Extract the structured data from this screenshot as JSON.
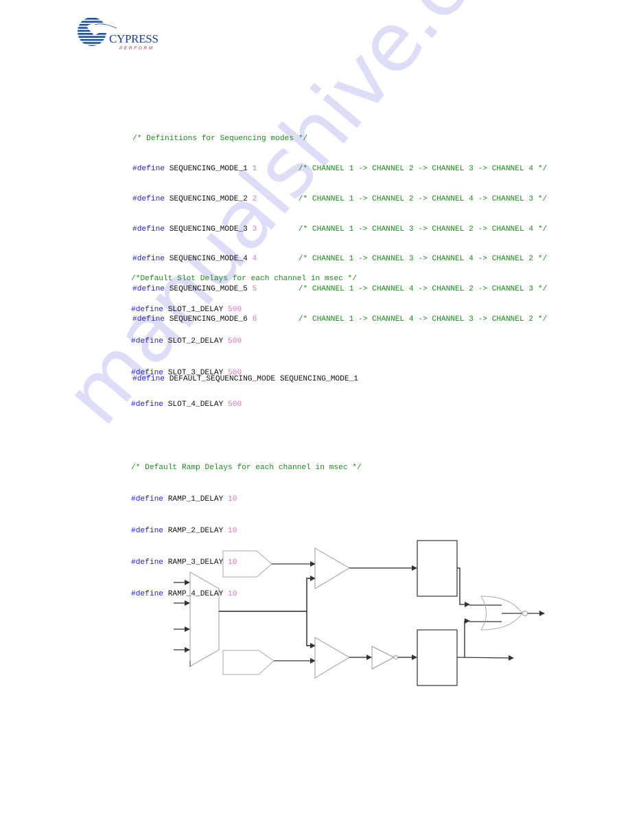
{
  "header": {
    "logo": {
      "brand": "CYPRESS",
      "tagline": "PERFORM",
      "colors": {
        "brand": "#1b3f8f",
        "tagline": "#c0312b"
      }
    }
  },
  "code_block_1": {
    "comment": "/* Definitions for Sequencing modes */",
    "defines": [
      {
        "keyword": "#define",
        "name": "SEQUENCING_MODE_1",
        "value": "1",
        "comment": "/* CHANNEL 1 -> CHANNEL 2 -> CHANNEL 3 -> CHANNEL 4 */"
      },
      {
        "keyword": "#define",
        "name": "SEQUENCING_MODE_2",
        "value": "2",
        "comment": "/* CHANNEL 1 -> CHANNEL 2 -> CHANNEL 4 -> CHANNEL 3 */"
      },
      {
        "keyword": "#define",
        "name": "SEQUENCING_MODE_3",
        "value": "3",
        "comment": "/* CHANNEL 1 -> CHANNEL 3 -> CHANNEL 2 -> CHANNEL 4 */"
      },
      {
        "keyword": "#define",
        "name": "SEQUENCING_MODE_4",
        "value": "4",
        "comment": "/* CHANNEL 1 -> CHANNEL 3 -> CHANNEL 4 -> CHANNEL 2 */"
      },
      {
        "keyword": "#define",
        "name": "SEQUENCING_MODE_5",
        "value": "5",
        "comment": "/* CHANNEL 1 -> CHANNEL 4 -> CHANNEL 2 -> CHANNEL 3 */"
      },
      {
        "keyword": "#define",
        "name": "SEQUENCING_MODE_6",
        "value": "6",
        "comment": "/* CHANNEL 1 -> CHANNEL 4 -> CHANNEL 3 -> CHANNEL 2 */"
      }
    ],
    "default_line": {
      "keyword": "#define",
      "name": "DEFAULT_SEQUENCING_MODE",
      "value": "SEQUENCING_MODE_1"
    }
  },
  "code_block_2": {
    "slot_comment": "/*Default Slot Delays for each channel in msec */",
    "slot_defines": [
      {
        "keyword": "#define",
        "name": "SLOT_1_DELAY",
        "value": "500"
      },
      {
        "keyword": "#define",
        "name": "SLOT_2_DELAY",
        "value": "500"
      },
      {
        "keyword": "#define",
        "name": "SLOT_3_DELAY",
        "value": "500"
      },
      {
        "keyword": "#define",
        "name": "SLOT_4_DELAY",
        "value": "500"
      }
    ],
    "ramp_comment": "/* Default Ramp Delays for each channel in msec */",
    "ramp_defines": [
      {
        "keyword": "#define",
        "name": "RAMP_1_DELAY",
        "value": "10"
      },
      {
        "keyword": "#define",
        "name": "RAMP_2_DELAY",
        "value": "10"
      },
      {
        "keyword": "#define",
        "name": "RAMP_3_DELAY",
        "value": "10"
      },
      {
        "keyword": "#define",
        "name": "RAMP_4_DELAY",
        "value": "10"
      }
    ]
  },
  "syntax_colors": {
    "keyword": "#2323c8",
    "identifier": "#111111",
    "number": "#d878c8",
    "comment": "#1e8a1e"
  },
  "diagram": {
    "description": "Block diagram: 4-input mux feeding two comparators (with DAC reference inputs), one comparator output inverted, two blocks, NOR gate output",
    "mux_inputs": 4,
    "components": [
      "mux",
      "dac-top",
      "dac-bottom",
      "comparator-top",
      "comparator-bottom",
      "inverter",
      "block-top",
      "block-bottom",
      "nor-gate"
    ]
  },
  "watermark": {
    "text": "manualshive.com"
  }
}
